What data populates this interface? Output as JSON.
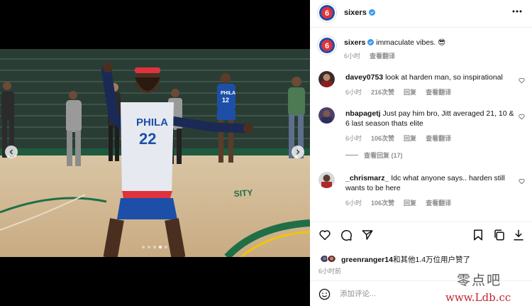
{
  "post": {
    "account": "sixers",
    "logo_text": "6",
    "caption_user": "sixers",
    "caption_text": "immaculate vibes. 😎",
    "caption_time": "6小时",
    "caption_translate": "查看翻译"
  },
  "photo": {
    "jersey_text": "PHILA",
    "jersey_number": "22",
    "back_jersey_text": "PHILA",
    "back_jersey_number": "12"
  },
  "comments": [
    {
      "user": "davey0753",
      "text": "look at harden man, so inspirational",
      "time": "6小时",
      "likes": "216次赞",
      "reply": "回复",
      "translate": "查看翻译"
    },
    {
      "user": "nbapagetj",
      "text": "Just pay him bro, Jitt averaged 21, 10 & 6 last season thats elite",
      "time": "6小时",
      "likes": "106次赞",
      "reply": "回复",
      "translate": "查看翻译",
      "replies_label": "查看回复 (17)"
    },
    {
      "user": "_chrismarz_",
      "text": "Idc what anyone says.. harden still wants to be here",
      "time": "6小时",
      "likes": "106次赞",
      "reply": "回复",
      "translate": "查看翻译"
    }
  ],
  "likes_bar": {
    "user": "greenranger14",
    "text": "和其他1.4万位用户赞了",
    "time": "6小时前"
  },
  "add_comment": {
    "placeholder": "添加评论..."
  },
  "watermark": {
    "line1": "零点吧",
    "line2": "www.Ldb.cc"
  },
  "colors": {
    "sixers_blue": "#1d4fa8",
    "sixers_red": "#e0323c",
    "verified_blue": "#3897f0",
    "meta_gray": "#8e8e8e"
  }
}
